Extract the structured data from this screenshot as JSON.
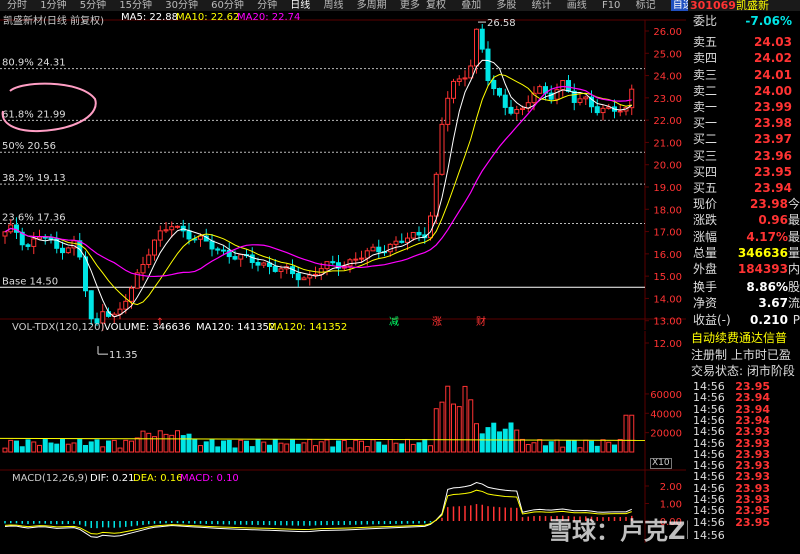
{
  "toolbar": {
    "periods": [
      "分时",
      "1分钟",
      "5分钟",
      "15分钟",
      "30分钟",
      "60分钟",
      "分钟",
      "日线",
      "周线",
      "多周期",
      "更多"
    ],
    "active_period": "日线",
    "tools": [
      "复权",
      "叠加",
      "多股",
      "统计",
      "画线",
      "F10",
      "标记",
      "自选",
      "返回"
    ],
    "active_tool": "自选"
  },
  "price_chart": {
    "title": "凯盛新材(日线 前复权)",
    "ma5_label": "MA5: 22.88",
    "ma10_label": "MA10: 22.62",
    "ma20_label": "MA20: 22.74",
    "fib_levels": [
      {
        "label": "80.9% 24.31",
        "price": 24.31
      },
      {
        "label": "61.8% 21.99",
        "price": 21.99
      },
      {
        "label": "50% 20.56",
        "price": 20.56
      },
      {
        "label": "38.2% 19.13",
        "price": 19.13
      },
      {
        "label": "23.6% 17.36",
        "price": 17.36
      },
      {
        "label": "Base 14.50",
        "price": 14.5
      }
    ],
    "high_marker": "26.58",
    "low_marker": "11.35",
    "y_ticks": [
      "26.00",
      "25.00",
      "24.00",
      "23.00",
      "22.00",
      "21.00",
      "20.00",
      "19.00",
      "18.00",
      "17.00",
      "16.00",
      "15.00",
      "14.00",
      "13.00",
      "12.00"
    ],
    "events": [
      {
        "text": "减"
      },
      {
        "text": "涨"
      },
      {
        "text": "财"
      }
    ]
  },
  "volume_chart": {
    "label": "VOL-TDX(120,120)",
    "volume": "VOLUME: 346636",
    "ma120": "MA120: 141352",
    "ma120b": "MA120: 141352",
    "y_ticks": [
      "60000",
      "40000",
      "20000"
    ],
    "unit": "X10"
  },
  "macd_chart": {
    "label": "MACD(12,26,9)",
    "dif": "DIF: 0.21",
    "dea": "DEA: 0.16",
    "macd": "MACD: 0.10",
    "y_ticks": [
      "2.00",
      "1.00",
      "0.00"
    ]
  },
  "watermark": "雪球：卢克ZhuKer",
  "side": {
    "code": "301069",
    "name": "凯盛新",
    "ratio": {
      "label": "委比",
      "value": "-7.06%"
    },
    "asks": [
      {
        "label": "卖五",
        "price": "24.03"
      },
      {
        "label": "卖四",
        "price": "24.02"
      },
      {
        "label": "卖三",
        "price": "24.01"
      },
      {
        "label": "卖二",
        "price": "24.00"
      },
      {
        "label": "卖一",
        "price": "23.99"
      }
    ],
    "bids": [
      {
        "label": "买一",
        "price": "23.98"
      },
      {
        "label": "买二",
        "price": "23.97"
      },
      {
        "label": "买三",
        "price": "23.96"
      },
      {
        "label": "买四",
        "price": "23.95"
      },
      {
        "label": "买五",
        "price": "23.94"
      }
    ],
    "stats": [
      {
        "label": "现价",
        "value": "23.98",
        "unit": "今",
        "color": "red"
      },
      {
        "label": "涨跌",
        "value": "0.96",
        "unit": "最",
        "color": "red"
      },
      {
        "label": "涨幅",
        "value": "4.17%",
        "unit": "最",
        "color": "red"
      },
      {
        "label": "总量",
        "value": "346636",
        "unit": "量",
        "color": "yel"
      },
      {
        "label": "外盘",
        "value": "184393",
        "unit": "内",
        "color": "red"
      }
    ],
    "stats2": [
      {
        "label": "换手",
        "value": "8.86%",
        "unit": "股",
        "color": "wht"
      },
      {
        "label": "净资",
        "value": "3.67",
        "unit": "流",
        "color": "wht"
      },
      {
        "label": "收益(-)",
        "value": "0.210",
        "unit": "P",
        "color": "wht"
      }
    ],
    "notices": [
      "自动续费通达信普",
      "注册制 上市时已盈",
      "交易状态: 闭市阶段"
    ],
    "trades": [
      {
        "time": "14:56",
        "price": "23.95"
      },
      {
        "time": "14:56",
        "price": "23.94"
      },
      {
        "time": "14:56",
        "price": "23.94"
      },
      {
        "time": "14:56",
        "price": "23.94"
      },
      {
        "time": "14:56",
        "price": "23.93"
      },
      {
        "time": "14:56",
        "price": "23.93"
      },
      {
        "time": "14:56",
        "price": "23.93"
      },
      {
        "time": "14:56",
        "price": "23.93"
      },
      {
        "time": "14:56",
        "price": "23.93"
      },
      {
        "time": "14:56",
        "price": "23.93"
      },
      {
        "time": "14:56",
        "price": "23.93"
      },
      {
        "time": "14:56",
        "price": "23.95"
      },
      {
        "time": "14:56",
        "price": "23.95"
      }
    ],
    "last_time": "14:56"
  },
  "colors": {
    "up": "#ff3333",
    "down": "#00e5e5",
    "ma5": "#ffffff",
    "ma10": "#ffff00",
    "ma20": "#ff00ff",
    "grid": "#5a0000"
  }
}
